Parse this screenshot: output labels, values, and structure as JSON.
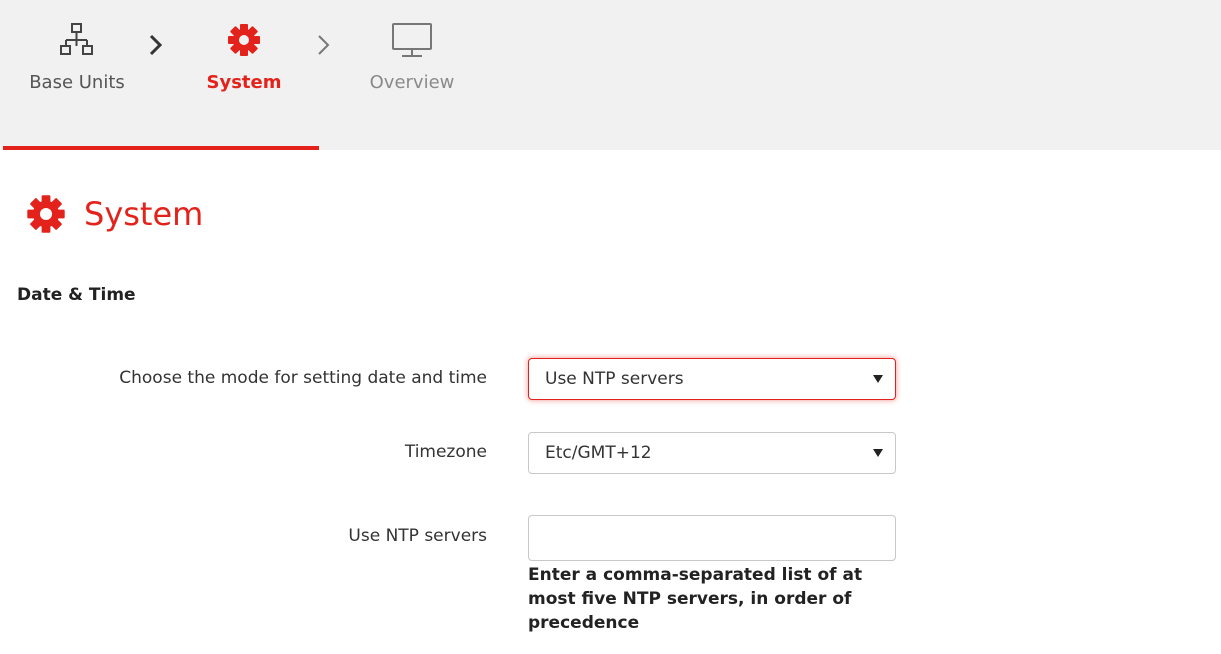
{
  "wizard": {
    "steps": [
      {
        "label": "Base Units",
        "icon": "network-icon",
        "state": "completed"
      },
      {
        "label": "System",
        "icon": "gear-icon",
        "state": "active"
      },
      {
        "label": "Overview",
        "icon": "monitor-icon",
        "state": "upcoming"
      }
    ]
  },
  "page": {
    "title": "System",
    "title_icon": "gear-icon"
  },
  "section": {
    "heading": "Date & Time"
  },
  "form": {
    "mode": {
      "label": "Choose the mode for setting date and time",
      "value": "Use NTP servers"
    },
    "timezone": {
      "label": "Timezone",
      "value": "Etc/GMT+12"
    },
    "ntp": {
      "label": "Use NTP servers",
      "value": "",
      "placeholder": "",
      "help": "Enter a comma-separated list of at most five NTP servers, in order of precedence"
    }
  },
  "colors": {
    "accent": "#e3231b",
    "bar_background": "#f1f1f1",
    "text": "#333333"
  }
}
